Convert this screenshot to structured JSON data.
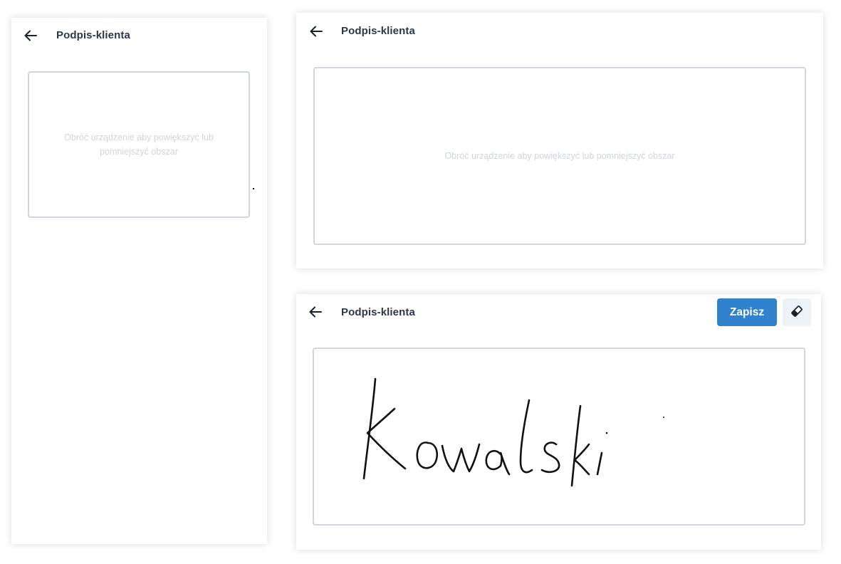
{
  "screens": [
    {
      "id": "portrait",
      "title": "Podpis-klienta",
      "hint": "Obróć urządzenie aby powiększyć lub pomniejszyć obszar",
      "back_icon": "arrow-left-icon"
    },
    {
      "id": "landscape-empty",
      "title": "Podpis-klienta",
      "hint": "Obróć urządzenie aby powiększyć lub pomniejszyć obszar",
      "back_icon": "arrow-left-icon"
    },
    {
      "id": "landscape-signed",
      "title": "Podpis-klienta",
      "save_label": "Zapisz",
      "eraser_icon": "eraser-icon",
      "back_icon": "arrow-left-icon",
      "signature_text": "Kowalski"
    }
  ],
  "colors": {
    "accent": "#3182ce",
    "title": "#2d3748",
    "pad_border": "#cfd6dd",
    "hint": "#cfd5de",
    "eraser_bg": "#edf2f7",
    "ink": "#111111"
  }
}
